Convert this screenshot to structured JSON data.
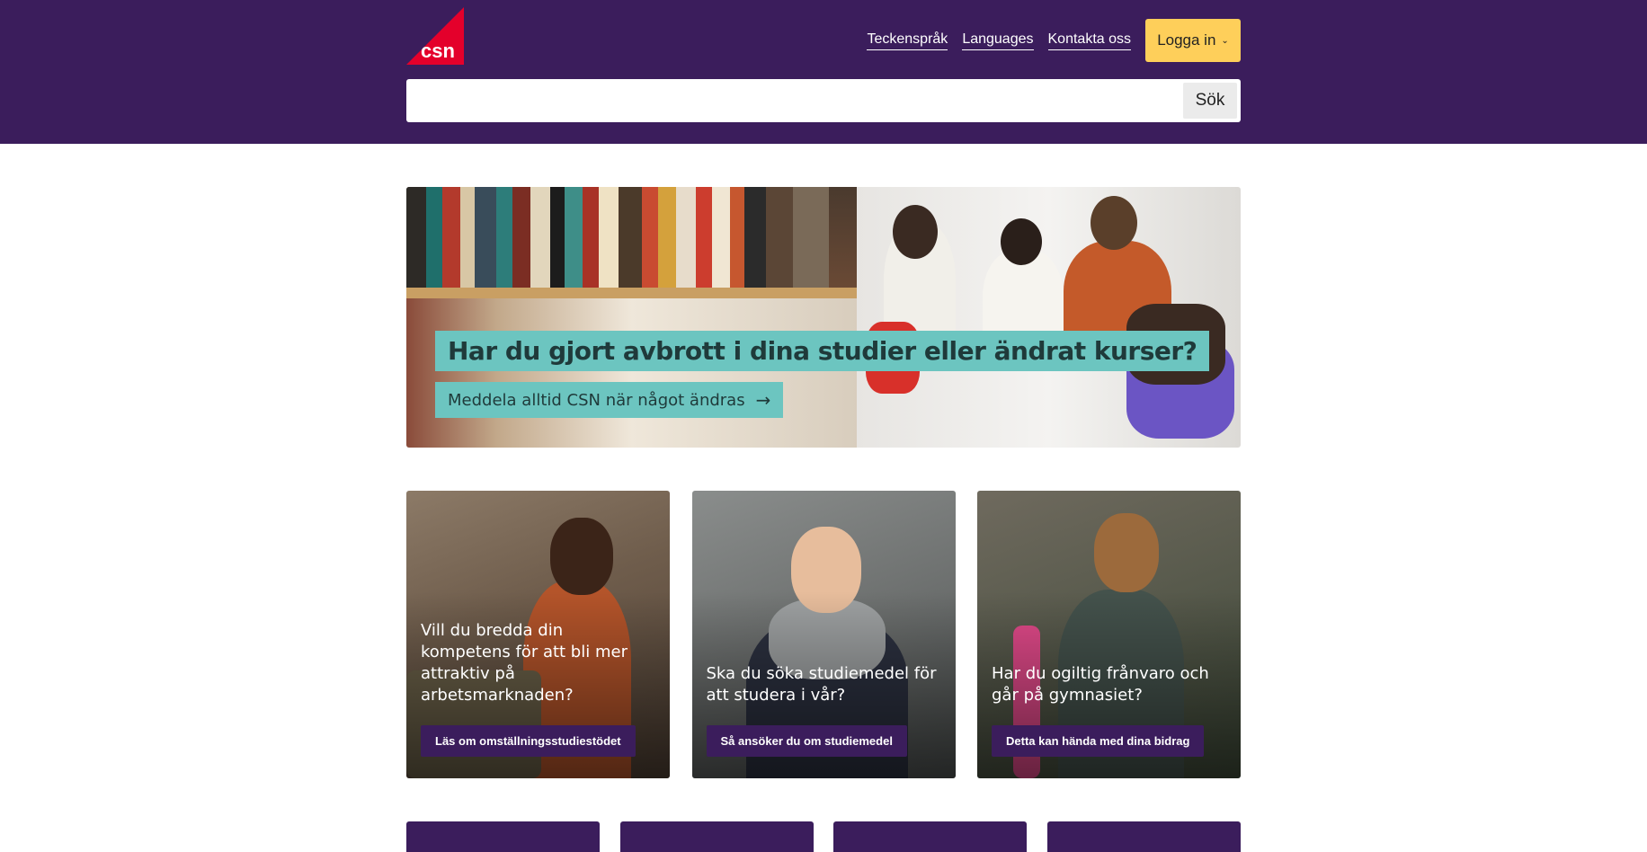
{
  "header": {
    "logo_text": "csn",
    "nav": [
      {
        "label": "Teckenspråk"
      },
      {
        "label": "Languages"
      },
      {
        "label": "Kontakta oss"
      }
    ],
    "login_label": "Logga in",
    "search": {
      "placeholder": "",
      "button_label": "Sök"
    }
  },
  "hero": {
    "title": "Har du gjort avbrott i dina studier eller ändrat kurser?",
    "link_label": "Meddela alltid CSN när något ändras"
  },
  "cards": [
    {
      "text": "Vill du bredda din kompetens för att bli mer attraktiv på arbetsmarknaden?",
      "button": "Läs om omställningsstudiestödet"
    },
    {
      "text": "Ska du söka studiemedel för att studera i vår?",
      "button": "Så ansöker du om studiemedel"
    },
    {
      "text": "Har du ogiltig frånvaro och går på gymnasiet?",
      "button": "Detta kan hända med dina bidrag"
    }
  ],
  "colors": {
    "brand_purple": "#3b1d5c",
    "login_yellow": "#fecf5a",
    "hero_teal": "#6cc5c0",
    "logo_red": "#e4002b"
  }
}
